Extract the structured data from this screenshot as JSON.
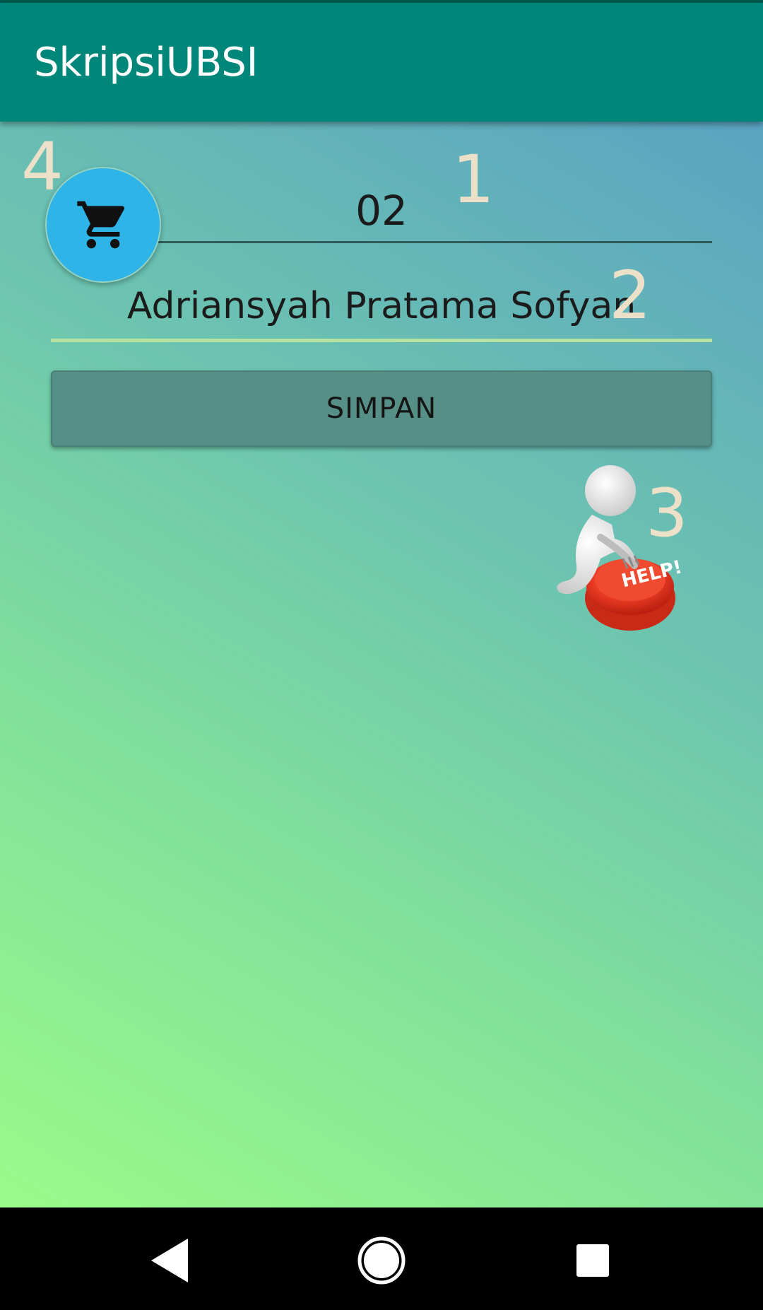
{
  "app": {
    "title": "SkripsiUBSI"
  },
  "form": {
    "field1": {
      "value": "02"
    },
    "field2": {
      "value": "Adriansyah Pratama Sofyan"
    },
    "save_label": "SIMPAN"
  },
  "annotations": {
    "n1": "1",
    "n2": "2",
    "n3": "3",
    "n4": "4"
  },
  "help_image": {
    "icon": "help-button-figure",
    "text": "HELP!"
  },
  "fab": {
    "icon": "cart-icon"
  },
  "navbar": {
    "back_icon": "back-icon",
    "home_icon": "home-icon",
    "recents_icon": "recents-icon"
  },
  "colors": {
    "appbar": "#00877a",
    "fab": "#2fb4e8",
    "button": "#568f86",
    "annotation": "#ede0c8",
    "field2_underline": "#b6e3a2"
  }
}
